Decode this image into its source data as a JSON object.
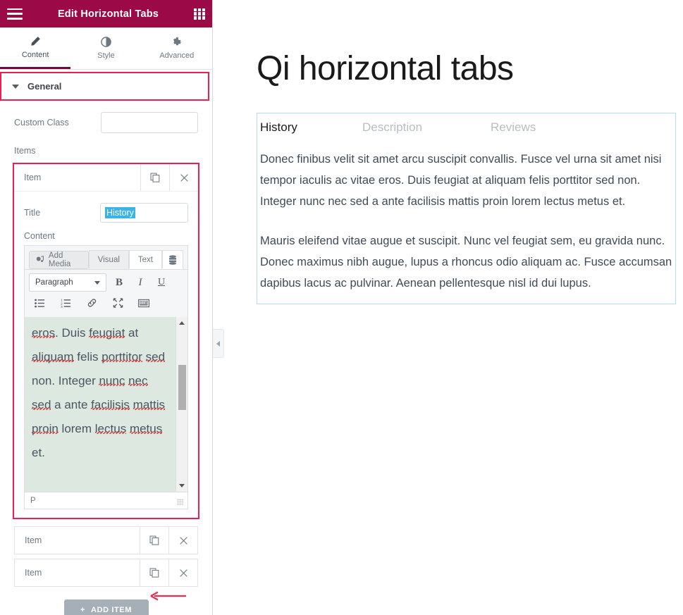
{
  "panel": {
    "header": {
      "title": "Edit Horizontal Tabs",
      "menu_icon": "hamburger-icon",
      "grid_icon": "grid-icon"
    },
    "tabs": [
      {
        "label": "Content",
        "icon": "pencil-icon",
        "active": true
      },
      {
        "label": "Style",
        "icon": "contrast-icon",
        "active": false
      },
      {
        "label": "Advanced",
        "icon": "gear-icon",
        "active": false
      }
    ],
    "section": {
      "title": "General",
      "collapse_icon": "caret-down-icon"
    },
    "custom_class": {
      "label": "Custom Class",
      "value": "",
      "placeholder": ""
    },
    "items_label": "Items",
    "items": [
      {
        "name": "Item",
        "expanded": true,
        "duplicate_icon": "duplicate-icon",
        "remove_icon": "close-icon",
        "title_label": "Title",
        "title_value": "History",
        "content_label": "Content"
      },
      {
        "name": "Item",
        "expanded": false,
        "duplicate_icon": "duplicate-icon",
        "remove_icon": "close-icon"
      },
      {
        "name": "Item",
        "expanded": false,
        "duplicate_icon": "duplicate-icon",
        "remove_icon": "close-icon"
      }
    ],
    "editor": {
      "add_media_label": "Add Media",
      "add_media_icon": "media-icon",
      "mode_visual": "Visual",
      "mode_text": "Text",
      "mode_extra_icon": "database-icon",
      "format_select": "Paragraph",
      "bold": "B",
      "italic": "I",
      "underline": "U",
      "icons_row2": [
        "bulleted-list-icon",
        "numbered-list-icon",
        "link-icon",
        "fullscreen-icon",
        "keyboard-shortcuts-icon"
      ],
      "body_text": "eros. Duis feugiat at aliquam felis porttitor sed non. Integer nunc nec sed a ante facilisis mattis proin lorem lectus metus et.",
      "status_path": "P",
      "scroll_up_icon": "scroll-up-arrow-icon",
      "scroll_down_icon": "scroll-down-arrow-icon",
      "resize_grip_icon": "resize-grip-icon"
    },
    "add_item_button": {
      "label": "ADD ITEM",
      "icon": "plus-icon"
    },
    "annotation_arrow": "left-arrow-annotation"
  },
  "preview": {
    "collapse_handle_icon": "chevron-left-icon",
    "title": "Qi horizontal tabs",
    "tabs": [
      {
        "label": "History",
        "active": true
      },
      {
        "label": "Description",
        "active": false
      },
      {
        "label": "Reviews",
        "active": false
      }
    ],
    "paragraphs": [
      "Donec finibus velit sit amet arcu suscipit convallis. Fusce vel urna sit amet nisi tempor iaculis ac vitae eros. Duis feugiat at aliquam felis porttitor sed non. Integer nunc nec sed a ante facilisis mattis proin lorem lectus metus et.",
      "Mauris eleifend vitae augue et suscipit. Nunc vel feugiat sem, eu gravida nunc. Donec maximus nibh augue, lupus a rhoncus odio aliquam ac. Fusce accumsan dapibus lacus ac pulvinar. Aenean pellentesque nisl id dui lupus."
    ]
  },
  "colors": {
    "header_bg": "#9b0a46",
    "active_tab_underline": "#77063b",
    "highlight_outline": "#ea1e50",
    "selection_bg": "#3bb4e5",
    "editor_bg": "#dce8e0",
    "add_item_bg": "#a4afb7",
    "preview_border": "#b7dcea"
  }
}
